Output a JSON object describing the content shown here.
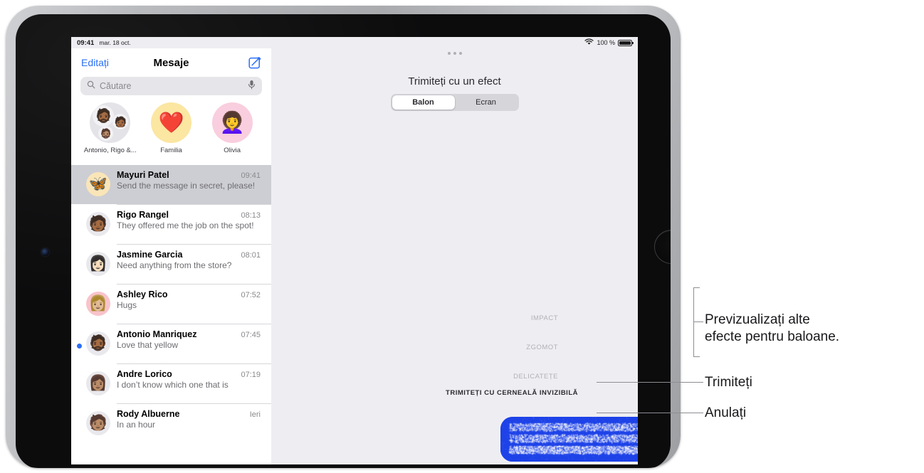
{
  "device": {
    "type": "ipad-landscape"
  },
  "status_bar": {
    "time": "09:41",
    "date": "mar. 18 oct.",
    "wifi_icon": "wifi-icon",
    "battery_percent": "100 %",
    "battery_icon": "battery-full-icon"
  },
  "sidebar": {
    "nav": {
      "edit_label": "Editați",
      "title": "Mesaje",
      "compose_icon": "compose-message-icon"
    },
    "search": {
      "placeholder": "Căutare",
      "search_icon": "search-icon",
      "dictate_icon": "microphone-icon"
    },
    "pinned": [
      {
        "label": "Antonio, Rigo &...",
        "type": "group",
        "emojis": [
          "🧔🏾",
          "🧑🏾",
          "🧔🏽"
        ],
        "bg": "#e4e4e8"
      },
      {
        "label": "Familia",
        "type": "single",
        "emoji": "❤️",
        "bg": "#fbe6a2"
      },
      {
        "label": "Olivia",
        "type": "single",
        "emoji": "👩‍🦱",
        "bg": "#f9cede"
      }
    ],
    "conversations": [
      {
        "name": "Mayuri Patel",
        "time": "09:41",
        "preview": "Send the message in secret, please!",
        "emoji": "🦋",
        "avatar_bg": "#fae5b8",
        "selected": true,
        "unread": false
      },
      {
        "name": "Rigo Rangel",
        "time": "08:13",
        "preview": "They offered me the job on the spot!",
        "emoji": "🧑🏾",
        "avatar_bg": "#e9e9ed",
        "selected": false,
        "unread": false
      },
      {
        "name": "Jasmine Garcia",
        "time": "08:01",
        "preview": "Need anything from the store?",
        "emoji": "👩🏻",
        "avatar_bg": "#e9e9ed",
        "selected": false,
        "unread": false
      },
      {
        "name": "Ashley Rico",
        "time": "07:52",
        "preview": "Hugs",
        "emoji": "👩🏼",
        "avatar_bg": "#f8c3cb",
        "selected": false,
        "unread": false
      },
      {
        "name": "Antonio Manriquez",
        "time": "07:45",
        "preview": "Love that yellow",
        "emoji": "🧔🏾",
        "avatar_bg": "#e9e9ed",
        "selected": false,
        "unread": true
      },
      {
        "name": "Andre Lorico",
        "time": "07:19",
        "preview": "I don’t know which one that is",
        "emoji": "👩🏽",
        "avatar_bg": "#e9e9ed",
        "selected": false,
        "unread": false
      },
      {
        "name": "Rody Albuerne",
        "time": "Ieri",
        "preview": "In an hour",
        "emoji": "🧑🏽",
        "avatar_bg": "#e9e9ed",
        "selected": false,
        "unread": false
      }
    ]
  },
  "detail": {
    "multitask_handle": "multitasking-handle-icon",
    "effect_title": "Trimiteți cu un efect",
    "segments": [
      {
        "label": "Balon",
        "selected": true
      },
      {
        "label": "Ecran",
        "selected": false
      }
    ],
    "effects": [
      {
        "label": "IMPACT",
        "active": false
      },
      {
        "label": "ZGOMOT",
        "active": false
      },
      {
        "label": "DELICATEȚE",
        "active": false
      },
      {
        "label": "TRIMITEȚI CU CERNEALĂ INVIZIBILĂ",
        "active": true
      }
    ],
    "bubble": {
      "style": "invisible-ink",
      "color": "#1d42e8"
    },
    "send_button": {
      "icon": "arrow-up-icon",
      "color": "#2b6ef5"
    },
    "cancel_button": {
      "icon": "close-x-icon",
      "color": "#5b5b60"
    }
  },
  "callouts": [
    {
      "text_line1": "Previzualizați alte",
      "text_line2": "efecte pentru baloane."
    },
    {
      "text_line1": "Trimiteți"
    },
    {
      "text_line1": "Anulați"
    }
  ],
  "colors": {
    "accent_blue": "#2b6ef5",
    "bubble_blue": "#1d42e8",
    "screen_bg": "#eeeef2",
    "selected_row": "#cdced3"
  }
}
